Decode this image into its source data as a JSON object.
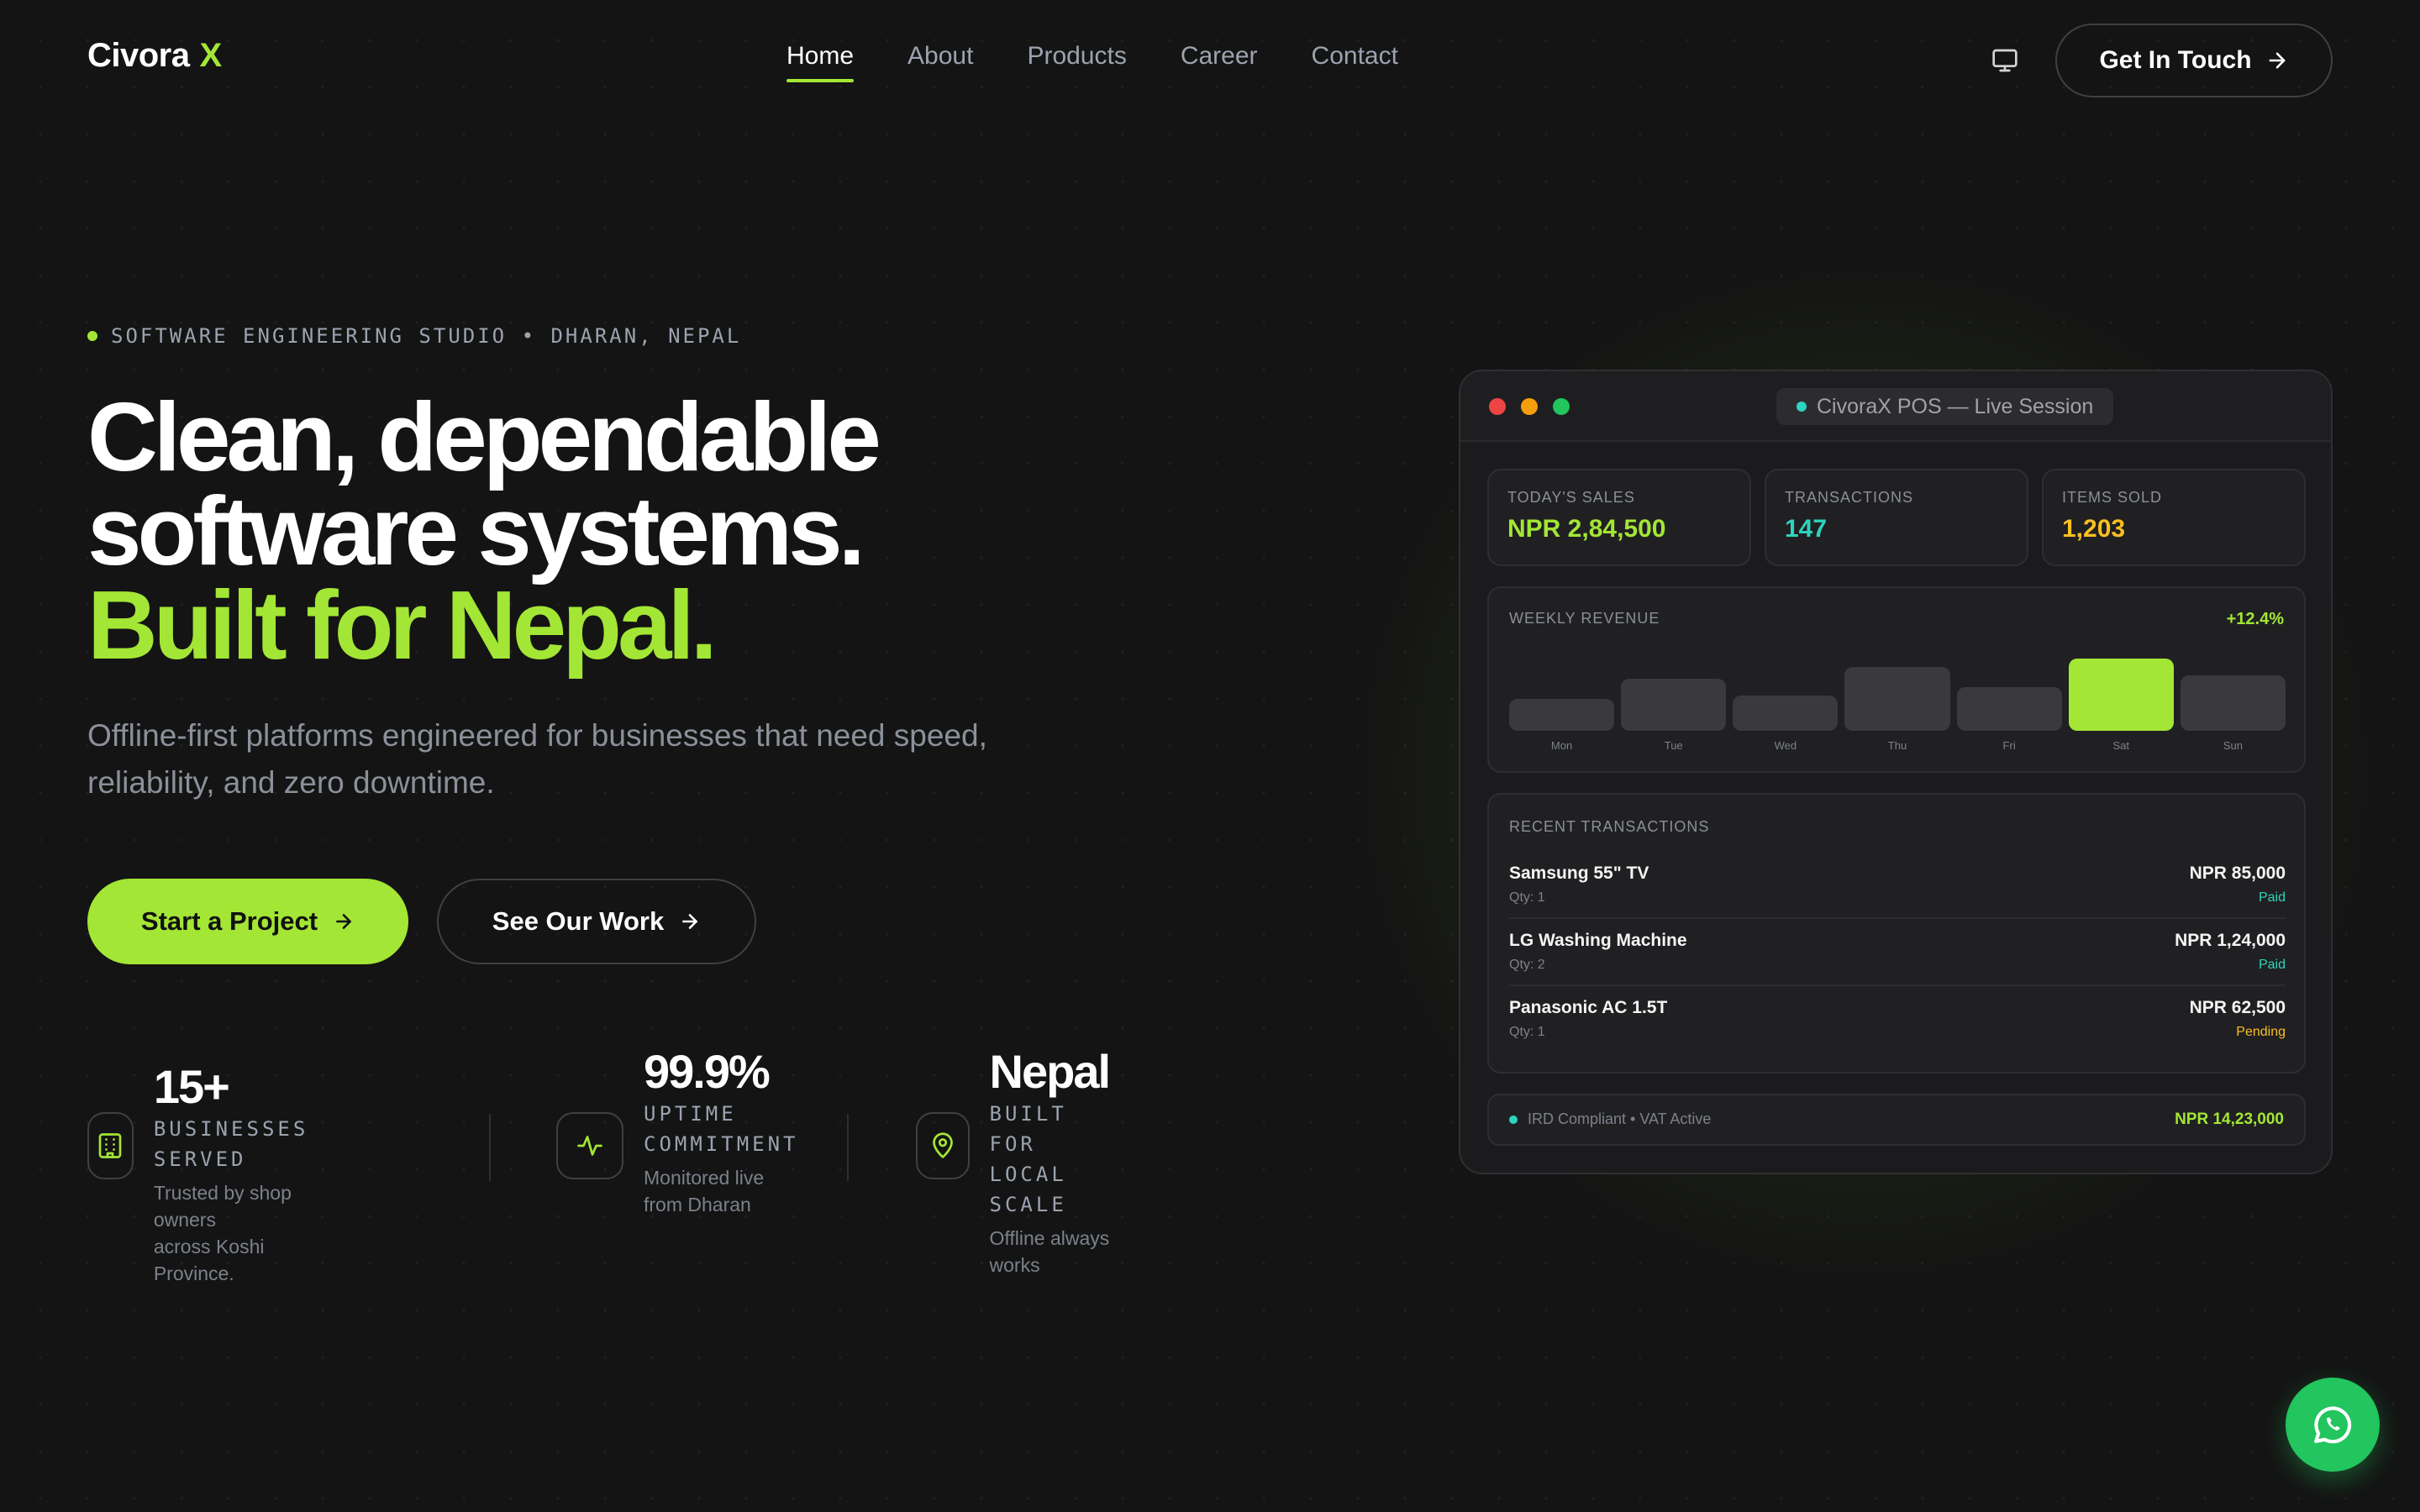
{
  "nav": {
    "logo_text": "Civora",
    "logo_mark": "X",
    "links": [
      "Home",
      "About",
      "Products",
      "Career",
      "Contact"
    ],
    "active_link": "Home",
    "monitor_icon": "monitor-icon",
    "cta_label": "Get In Touch"
  },
  "hero": {
    "eyebrow": "SOFTWARE ENGINEERING STUDIO • DHARAN, NEPAL",
    "headline_line1": "Clean, dependable",
    "headline_line2": "software systems.",
    "headline_line3": "Built for Nepal.",
    "subtitle": "Offline-first platforms engineered for businesses that need speed, reliability, and zero downtime.",
    "primary_cta": "Start a Project",
    "secondary_cta": "See Our Work"
  },
  "stats": [
    {
      "value": "15+",
      "label_line1": "BUSINESSES SERVED",
      "label_line2": "",
      "desc_line1": "Trusted by shop owners",
      "desc_line2": "across Koshi Province.",
      "icon": "building-icon"
    },
    {
      "value": "99.9%",
      "label_line1": "UPTIME",
      "label_line2": "COMMITMENT",
      "desc_line1": "Monitored live",
      "desc_line2": "from Dharan",
      "icon": "activity-icon"
    },
    {
      "value": "Nepal",
      "label_line1": "BUILT FOR",
      "label_line2": "LOCAL SCALE",
      "desc_line1": "Offline always",
      "desc_line2": "works",
      "icon": "map-pin-icon"
    }
  ],
  "dashboard": {
    "session_title": "CivoraX POS — Live Session",
    "kpis": [
      {
        "label": "TODAY'S SALES",
        "value": "NPR 2,84,500",
        "color": "#a3e635"
      },
      {
        "label": "TRANSACTIONS",
        "value": "147",
        "color": "#2dd4bf"
      },
      {
        "label": "ITEMS SOLD",
        "value": "1,203",
        "color": "#fbbf24"
      }
    ],
    "revenue": {
      "title": "WEEKLY REVENUE",
      "change": "+12.4%"
    },
    "transactions_title": "RECENT TRANSACTIONS",
    "transactions": [
      {
        "name": "Samsung 55\" TV",
        "qty": "Qty: 1",
        "amount": "NPR 85,000",
        "status": "Paid",
        "status_color": "#2dd4bf"
      },
      {
        "name": "LG Washing Machine",
        "qty": "Qty: 2",
        "amount": "NPR 1,24,000",
        "status": "Paid",
        "status_color": "#2dd4bf"
      },
      {
        "name": "Panasonic AC 1.5T",
        "qty": "Qty: 1",
        "amount": "NPR 62,500",
        "status": "Pending",
        "status_color": "#fbbf24"
      }
    ],
    "footer_left": "IRD Compliant • VAT Active",
    "footer_right": "NPR 14,23,000"
  },
  "chart_data": {
    "type": "bar",
    "title": "WEEKLY REVENUE",
    "categories": [
      "Mon",
      "Tue",
      "Wed",
      "Thu",
      "Fri",
      "Sat",
      "Sun"
    ],
    "values": [
      38,
      62,
      42,
      76,
      52,
      86,
      66
    ],
    "highlight": "Sat",
    "ylim": [
      0,
      100
    ],
    "colors": {
      "default": "#3a3a3e",
      "highlight": "#a3e635"
    }
  },
  "floating": {
    "icon": "whatsapp-icon"
  },
  "colors": {
    "accent": "#a3e635",
    "background": "#141414",
    "teal": "#2dd4bf",
    "amber": "#fbbf24"
  }
}
